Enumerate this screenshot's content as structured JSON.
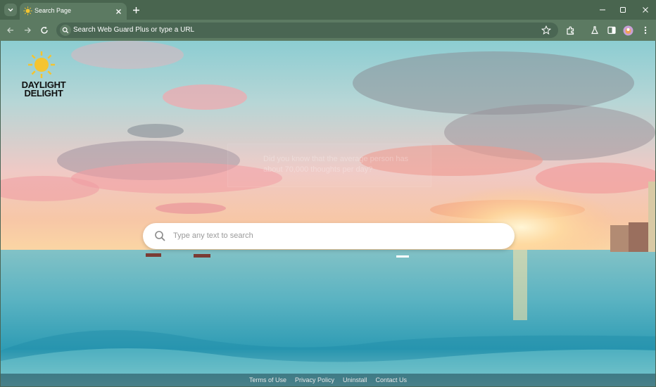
{
  "browser": {
    "tab": {
      "title": "Search Page",
      "favicon": "sun-icon"
    },
    "omnibox": {
      "placeholder": "Search Web Guard Plus or type a URL"
    },
    "icons": [
      "tab-menu-icon",
      "close-icon",
      "plus-icon",
      "minimize-icon",
      "maximize-icon",
      "window-close-icon",
      "back-arrow-icon",
      "forward-arrow-icon",
      "reload-icon",
      "search-icon",
      "star-icon",
      "extensions-icon",
      "labs-flask-icon",
      "side-panel-icon",
      "profile-avatar",
      "kebab-menu-icon"
    ]
  },
  "page": {
    "logo": {
      "line1": "DAYLIGHT",
      "line2": "DELIGHT"
    },
    "fact": "Did you know that the average person has about 70,000 thoughts per day?",
    "search": {
      "placeholder": "Type any text to search"
    },
    "footer_links": [
      "Terms of Use",
      "Privacy Policy",
      "Uninstall",
      "Contact Us"
    ]
  },
  "colors": {
    "chrome": "#49654f",
    "toolbar": "#5c7a62",
    "omnibox": "#4a6653",
    "logo_sun": "#f4c430"
  }
}
